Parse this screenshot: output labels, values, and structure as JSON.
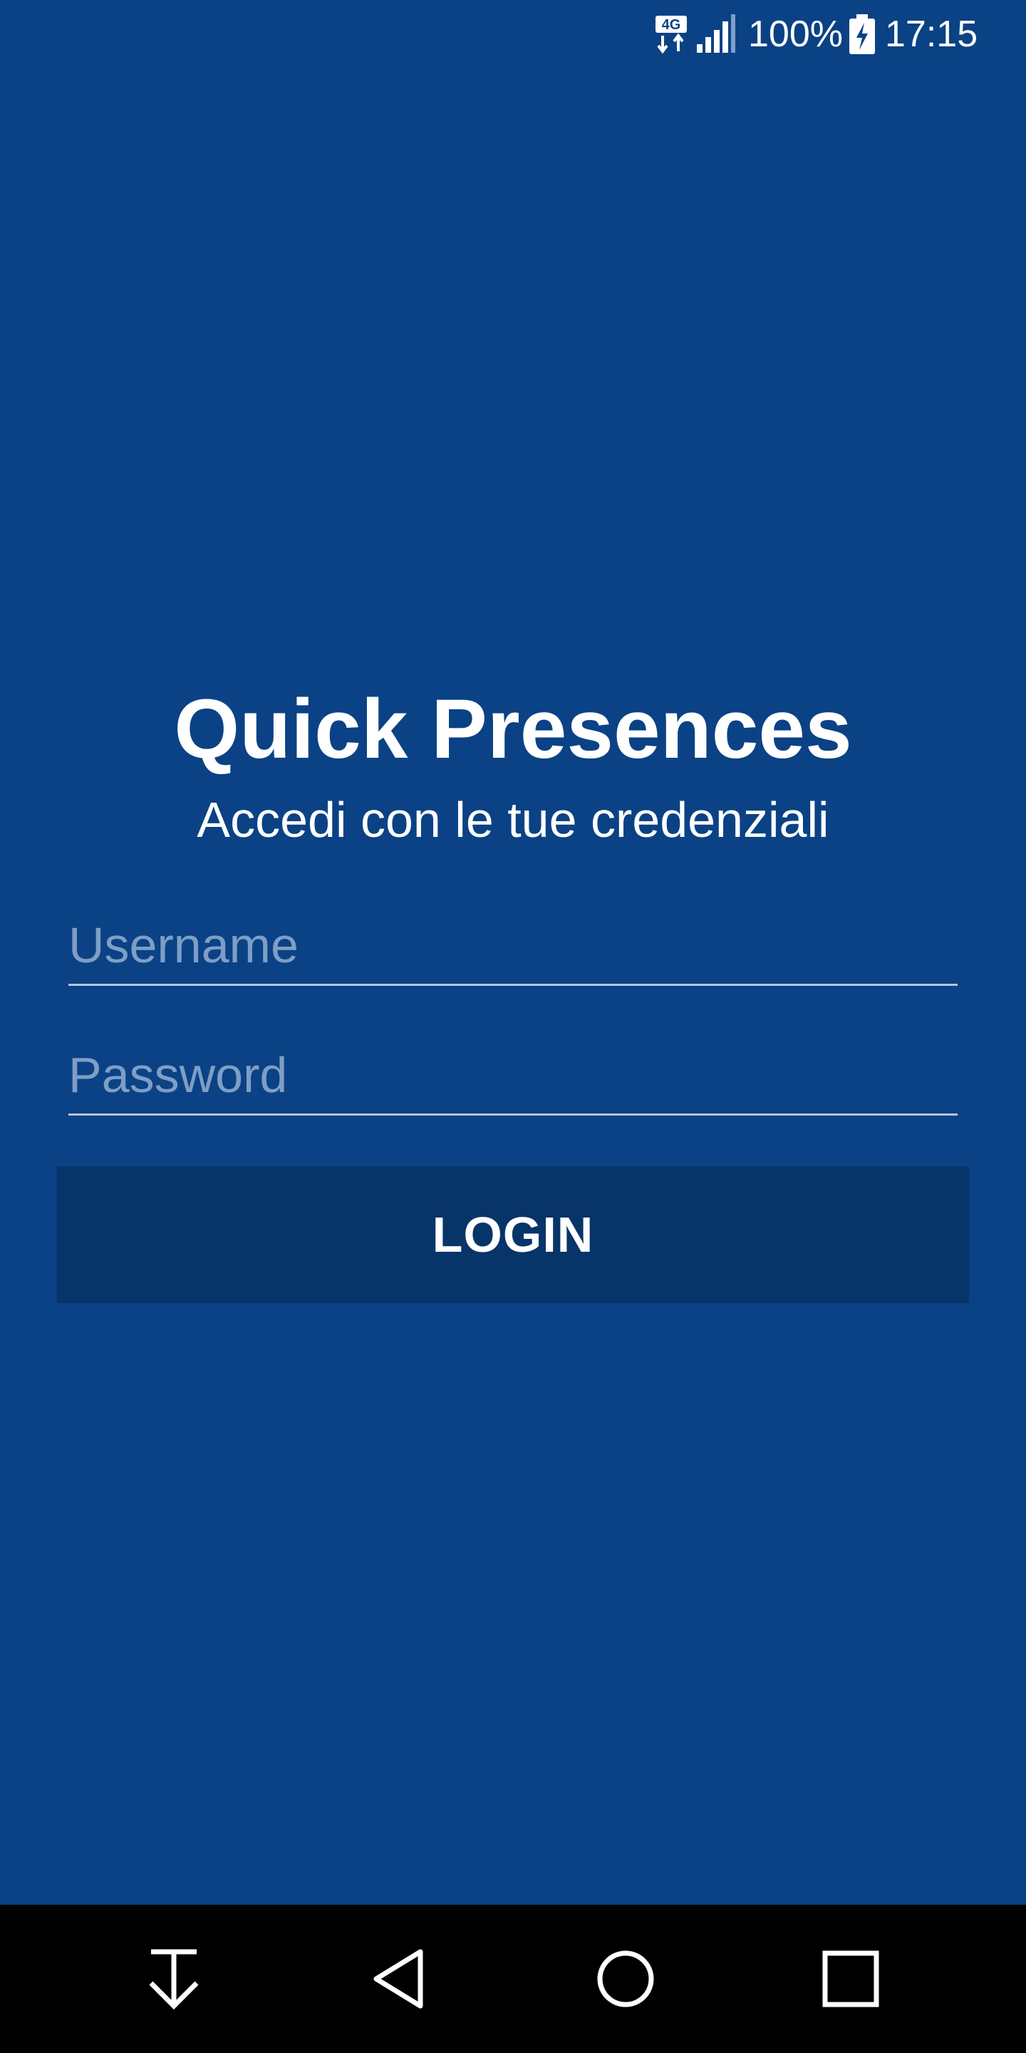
{
  "status_bar": {
    "network_label": "4G",
    "network_icon": "4g-data-icon",
    "signal_icon": "signal-strength-icon",
    "battery_percent": "100%",
    "battery_icon": "battery-charging-icon",
    "time": "17:15"
  },
  "login": {
    "title": "Quick Presences",
    "subtitle": "Accedi con le tue credenziali",
    "username_placeholder": "Username",
    "username_value": "",
    "password_placeholder": "Password",
    "password_value": "",
    "login_label": "LOGIN"
  },
  "nav_bar": {
    "download_icon": "download-icon",
    "back_icon": "back-triangle-icon",
    "home_icon": "home-circle-icon",
    "recent_icon": "recent-apps-square-icon"
  },
  "colors": {
    "background": "#0a4285",
    "button": "#073469",
    "placeholder": "#7f9ec6",
    "underline": "#b8c6dc",
    "nav_bar": "#000000",
    "text": "#ffffff"
  }
}
